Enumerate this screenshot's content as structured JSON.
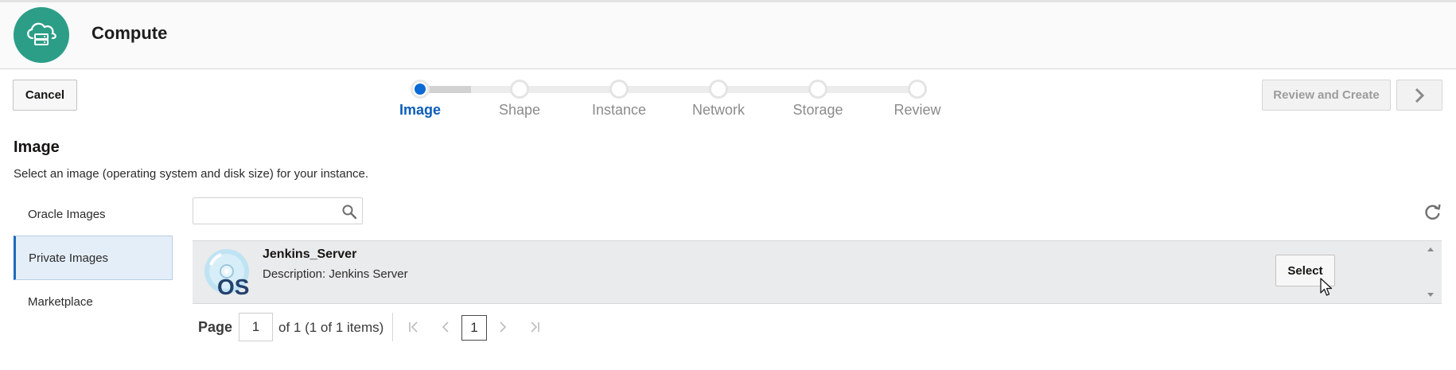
{
  "header": {
    "title": "Compute",
    "logo_icon": "cloud-server-icon",
    "logo_color": "#2c9e88"
  },
  "toolbar": {
    "cancel_label": "Cancel",
    "review_label": "Review and Create",
    "next_icon": "chevron-right-icon"
  },
  "train": {
    "steps": [
      {
        "label": "Image",
        "state": "current"
      },
      {
        "label": "Shape",
        "state": "pending"
      },
      {
        "label": "Instance",
        "state": "pending"
      },
      {
        "label": "Network",
        "state": "pending"
      },
      {
        "label": "Storage",
        "state": "pending"
      },
      {
        "label": "Review",
        "state": "pending"
      }
    ],
    "accent": "#0b6ad5"
  },
  "section": {
    "title": "Image",
    "description": "Select an image (operating system and disk size) for your instance."
  },
  "sidebar": {
    "items": [
      {
        "label": "Oracle Images",
        "selected": false
      },
      {
        "label": "Private Images",
        "selected": true
      },
      {
        "label": "Marketplace",
        "selected": false
      }
    ]
  },
  "search": {
    "value": "",
    "placeholder": "",
    "icon": "search-icon"
  },
  "images": [
    {
      "name": "Jenkins_Server",
      "description": "Description: Jenkins Server",
      "icon": "os-disc-icon",
      "action_label": "Select"
    }
  ],
  "pager": {
    "page_label": "Page",
    "current_page": "1",
    "summary": "of 1 (1 of 1 items)",
    "page_number": "1"
  }
}
